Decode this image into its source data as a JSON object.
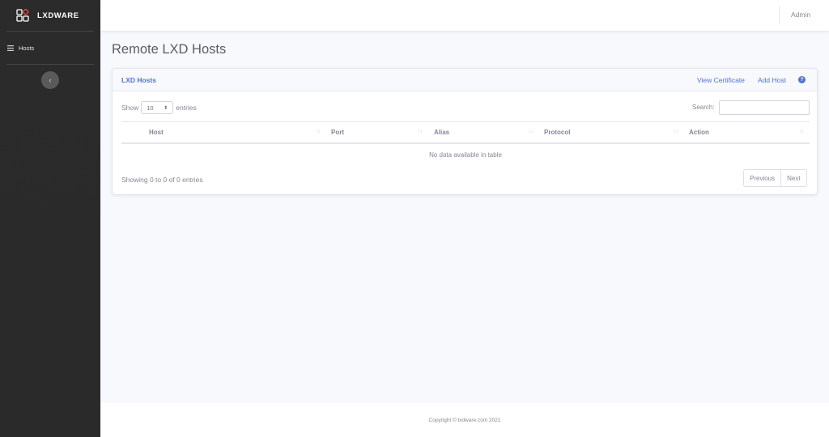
{
  "brand": {
    "name": "LXDWARE",
    "logo_icon": "lxdware-logo-icon"
  },
  "sidebar": {
    "items": [
      {
        "label": "Hosts",
        "icon": "list-icon"
      }
    ],
    "toggle_glyph": "‹"
  },
  "topbar": {
    "user": "Admin"
  },
  "page": {
    "title": "Remote LXD Hosts"
  },
  "card": {
    "title": "LXD Hosts",
    "actions": {
      "view_certificate": "View Certificate",
      "add_host": "Add Host",
      "help_glyph": "?"
    }
  },
  "table_controls": {
    "show_label": "Show",
    "entries_label": "entries",
    "page_length": "10",
    "search_label": "Search:",
    "search_value": ""
  },
  "table": {
    "columns": [
      "Host",
      "Port",
      "Alias",
      "Protocol",
      "Action"
    ],
    "empty_message": "No data available in table"
  },
  "pagination": {
    "info": "Showing 0 to 0 of 0 entries",
    "previous": "Previous",
    "next": "Next"
  },
  "footer": {
    "copyright": "Copyright © lxdware.com 2021"
  },
  "colors": {
    "accent": "#4e73df",
    "sidebar": "#2b2b2b",
    "logo_red": "#e74a3b"
  }
}
